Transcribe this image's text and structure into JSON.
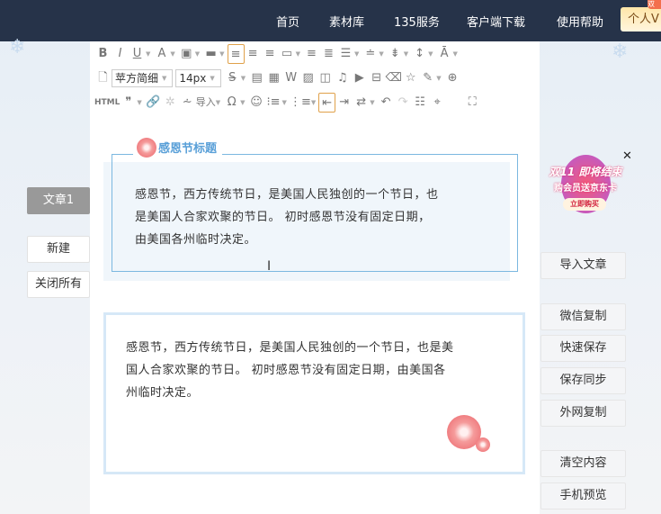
{
  "nav": {
    "items": [
      "首页",
      "素材库",
      "135服务",
      "客户端下载",
      "使用帮助"
    ],
    "vip_label": "个人V",
    "vip_badge": "双"
  },
  "left": {
    "tab": "文章1",
    "new": "新建",
    "close_all": "关闭所有"
  },
  "toolbar": {
    "font_family": "苹方简细",
    "font_size": "14px",
    "html_label": "HTML",
    "import_label": "导入"
  },
  "content": {
    "block1_title": "感恩节标题",
    "block1_lines": [
      "感恩节，西方传统节日，是美国人民独创的一个节日，也",
      "是美国人合家欢聚的节日。 初时感恩节没有固定日期，",
      "由美国各州临时决定。"
    ],
    "block2_lines": [
      "感恩节，西方传统节日，是美国人民独创的一个节日，也是美",
      "国人合家欢聚的节日。 初时感恩节没有固定日期，由美国各",
      "州临时决定。"
    ]
  },
  "right": {
    "buttons": [
      "导入文章",
      "微信复制",
      "快速保存",
      "保存同步",
      "外网复制",
      "清空内容",
      "手机预览"
    ]
  },
  "promo": {
    "line1": "双11 即将结束",
    "line2": "购会员送京东卡",
    "cta": "立即购买",
    "close": "✕"
  }
}
